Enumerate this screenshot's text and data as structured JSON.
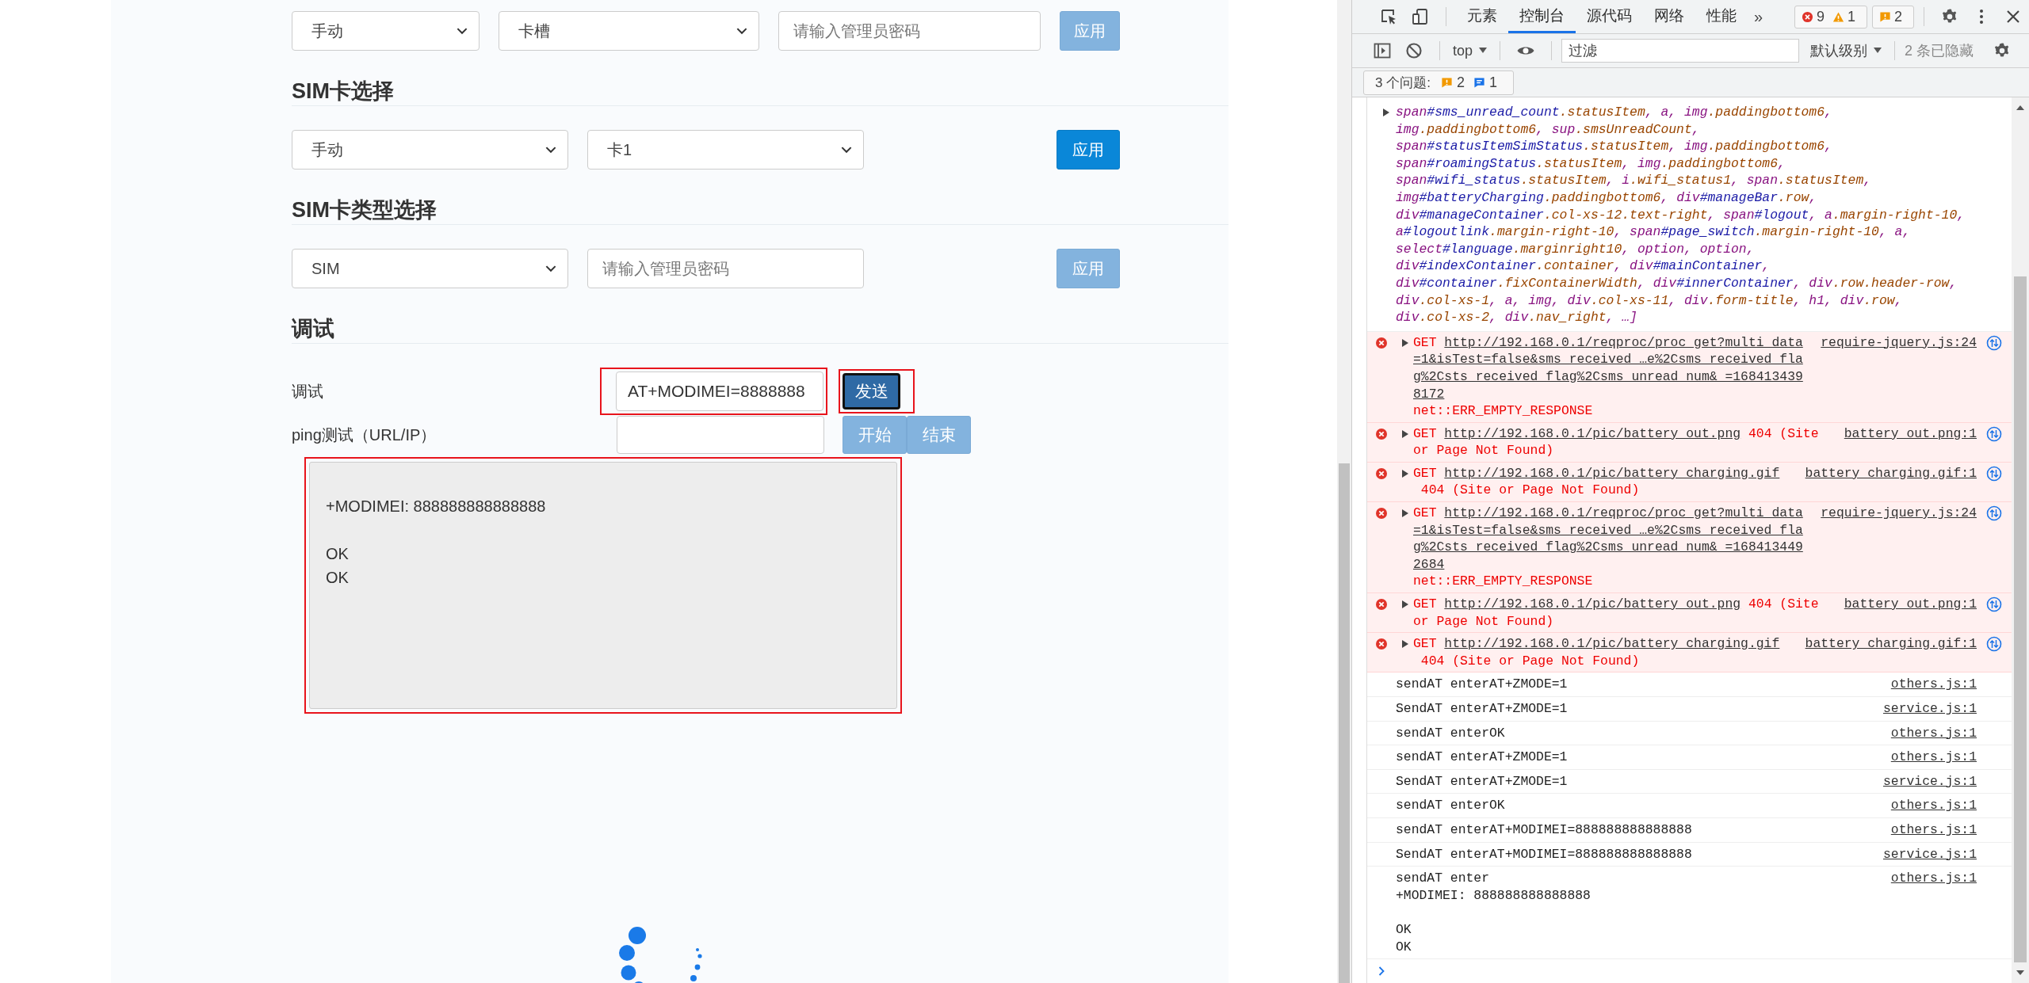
{
  "page": {
    "slot_row": {
      "selects": [
        {
          "value": "手动"
        },
        {
          "value": "卡槽"
        }
      ],
      "password": {
        "placeholder": "请输入管理员密码"
      },
      "apply": {
        "label": "应用",
        "disabled": true
      }
    },
    "sim_select": {
      "title": "SIM卡选择",
      "selects": [
        {
          "value": "手动"
        },
        {
          "value": "卡1"
        }
      ],
      "apply": {
        "label": "应用",
        "disabled": false
      }
    },
    "sim_type": {
      "title": "SIM卡类型选择",
      "selects": [
        {
          "value": "SIM"
        }
      ],
      "password": {
        "placeholder": "请输入管理员密码"
      },
      "apply": {
        "label": "应用",
        "disabled": true
      }
    },
    "debug": {
      "title": "调试",
      "at_label": "调试",
      "at_input": {
        "value": "AT+MODIMEI=8888888",
        "highlighted": true
      },
      "send": {
        "label": "发送",
        "highlighted": true
      },
      "ping_label": "ping测试（URL/IP）",
      "start": {
        "label": "开始",
        "disabled": true
      },
      "stop": {
        "label": "结束",
        "disabled": true
      },
      "output": {
        "text": "+MODIMEI: 888888888888888\n\nOK\nOK",
        "highlighted": true
      }
    }
  },
  "devtools": {
    "tabs": [
      {
        "label": "元素",
        "selected": false
      },
      {
        "label": "控制台",
        "selected": true
      },
      {
        "label": "源代码",
        "selected": false
      },
      {
        "label": "网络",
        "selected": false
      },
      {
        "label": "性能",
        "selected": false
      }
    ],
    "more_tabs": "»",
    "error_count": "9",
    "warning_count": "1",
    "issue_count": "2",
    "context": "top",
    "filter": {
      "placeholder": "过滤"
    },
    "level": "默认级别",
    "hidden": "2 条已隐藏",
    "issues": {
      "label": "3 个问题:",
      "warnings": "2",
      "infos": "1"
    },
    "messages": [
      {
        "kind": "object",
        "lines": [
          "span#sms_unread_count.statusItem, a, img.paddingbottom6,",
          "img.paddingbottom6, sup.smsUnreadCount,",
          "span#statusItemSimStatus.statusItem, img.paddingbottom6,",
          "span#roamingStatus.statusItem, img.paddingbottom6,",
          "span#wifi_status.statusItem, i.wifi_status1, span.statusItem,",
          "img#batteryCharging.paddingbottom6, div#manageBar.row,",
          "div#manageContainer.col-xs-12.text-right, span#logout, a.margin-right-10,",
          "a#logoutlink.margin-right-10, span#page_switch.margin-right-10, a,",
          "select#language.marginright10, option, option,",
          "div#indexContainer.container, div#mainContainer,",
          "div#container.fixContainerWidth, div#innerContainer, div.row.header-row,",
          "div.col-xs-1, a, img, div.col-xs-11, div.form-title, h1, div.row,",
          "div.col-xs-2, div.nav_right, …]"
        ]
      },
      {
        "kind": "request-error",
        "method": "GET",
        "url": "http://192.168.0.1/reqproc/proc_get?multi_data=1&isTest=false&sms_received_…e%2Csms_received_flag%2Csts_received_flag%2Csms_unread_num&_=1684134398172",
        "detail": "net::ERR_EMPTY_RESPONSE",
        "source": "require-jquery.js:24"
      },
      {
        "kind": "status-error",
        "method": "GET",
        "url": "http://192.168.0.1/pic/battery_out.png",
        "detail": "404 (Site or Page Not Found)",
        "source": "battery_out.png:1"
      },
      {
        "kind": "status-error",
        "method": "GET",
        "url": "http://192.168.0.1/pic/battery_charging.gif",
        "detail": "404 (Site or Page Not Found)",
        "source": "battery_charging.gif:1"
      },
      {
        "kind": "request-error",
        "method": "GET",
        "url": "http://192.168.0.1/reqproc/proc_get?multi_data=1&isTest=false&sms_received_…e%2Csms_received_flag%2Csts_received_flag%2Csms_unread_num&_=1684134492684",
        "detail": "net::ERR_EMPTY_RESPONSE",
        "source": "require-jquery.js:24"
      },
      {
        "kind": "status-error",
        "method": "GET",
        "url": "http://192.168.0.1/pic/battery_out.png",
        "detail": "404 (Site or Page Not Found)",
        "source": "battery_out.png:1"
      },
      {
        "kind": "status-error",
        "method": "GET",
        "url": "http://192.168.0.1/pic/battery_charging.gif",
        "detail": "404 (Site or Page Not Found)",
        "source": "battery_charging.gif:1"
      },
      {
        "kind": "log",
        "text": "sendAT enterAT+ZMODE=1",
        "source": "others.js:1"
      },
      {
        "kind": "log",
        "text": "SendAT enterAT+ZMODE=1",
        "source": "service.js:1"
      },
      {
        "kind": "log",
        "text": "sendAT enterOK",
        "source": "others.js:1"
      },
      {
        "kind": "log",
        "text": "sendAT enterAT+ZMODE=1",
        "source": "others.js:1"
      },
      {
        "kind": "log",
        "text": "SendAT enterAT+ZMODE=1",
        "source": "service.js:1"
      },
      {
        "kind": "log",
        "text": "sendAT enterOK",
        "source": "others.js:1"
      },
      {
        "kind": "log",
        "text": "sendAT enterAT+MODIMEI=888888888888888",
        "source": "others.js:1"
      },
      {
        "kind": "log",
        "text": "SendAT enterAT+MODIMEI=888888888888888",
        "source": "service.js:1"
      },
      {
        "kind": "log",
        "text": "sendAT enter\n+MODIMEI: 888888888888888\n\nOK\nOK",
        "source": "others.js:1"
      }
    ]
  }
}
